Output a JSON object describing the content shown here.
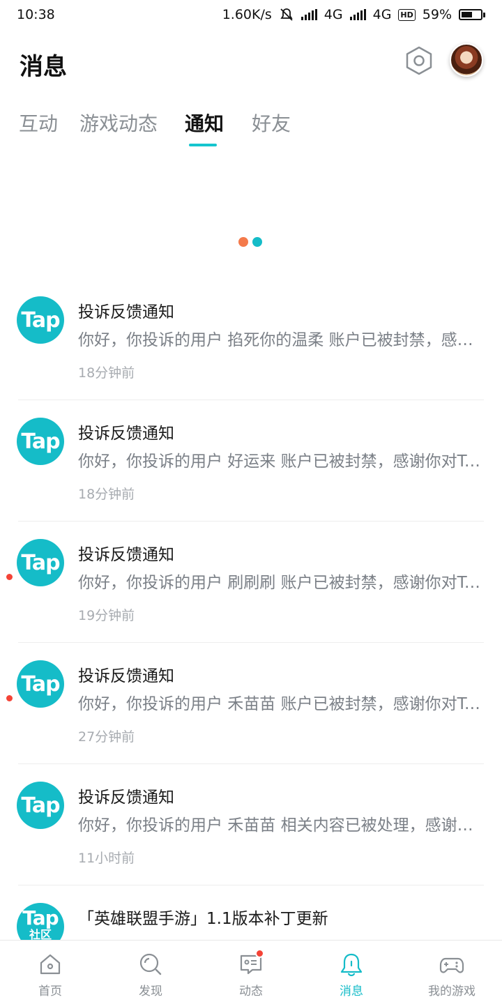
{
  "status_bar": {
    "time": "10:38",
    "net_speed": "1.60K/s",
    "network_1": "4G",
    "network_2": "4G",
    "hd": "HD",
    "battery": "59%"
  },
  "header": {
    "title": "消息",
    "settings_icon": "settings-hexagon-icon",
    "avatar_icon": "user-avatar"
  },
  "tabs": [
    {
      "label": "互动",
      "active": false
    },
    {
      "label": "游戏动态",
      "active": false
    },
    {
      "label": "通知",
      "active": true
    },
    {
      "label": "好友",
      "active": false
    }
  ],
  "loading_colors": [
    "#f47a4b",
    "#15bcc8"
  ],
  "notifications": [
    {
      "logo": "Tap",
      "title": "投诉反馈通知",
      "body": "你好，你投诉的用户 掐死你的温柔 账户已被封禁，感谢你对TapTap社区的支持",
      "time": "18分钟前",
      "unread": false
    },
    {
      "logo": "Tap",
      "title": "投诉反馈通知",
      "body": "你好，你投诉的用户 好运来 账户已被封禁，感谢你对TapTap社区的支持",
      "time": "18分钟前",
      "unread": false
    },
    {
      "logo": "Tap",
      "title": "投诉反馈通知",
      "body": "你好，你投诉的用户 刷刷刷 账户已被封禁，感谢你对TapTap社区的支持",
      "time": "19分钟前",
      "unread": true
    },
    {
      "logo": "Tap",
      "title": "投诉反馈通知",
      "body": "你好，你投诉的用户 禾苗苗 账户已被封禁，感谢你对TapTap社区的支持",
      "time": "27分钟前",
      "unread": true
    },
    {
      "logo": "Tap",
      "title": "投诉反馈通知",
      "body": "你好，你投诉的用户 禾苗苗 相关内容已被处理，感谢你对TapTap社区的支持",
      "time": "11小时前",
      "unread": false
    },
    {
      "logo": "Tap",
      "logo_sub": "社区",
      "title": "「英雄联盟手游」1.1版本补丁更新",
      "body": "",
      "time": "",
      "unread": false
    }
  ],
  "bottom_nav": [
    {
      "label": "首页",
      "icon": "home-icon",
      "active": false
    },
    {
      "label": "发现",
      "icon": "discover-icon",
      "active": false
    },
    {
      "label": "动态",
      "icon": "moments-icon",
      "active": false,
      "badge": true
    },
    {
      "label": "消息",
      "icon": "bell-icon",
      "active": true
    },
    {
      "label": "我的游戏",
      "icon": "gamepad-icon",
      "active": false
    }
  ],
  "colors": {
    "accent": "#15bcc8",
    "badge": "#f44336",
    "inactive": "#8a8f94"
  }
}
